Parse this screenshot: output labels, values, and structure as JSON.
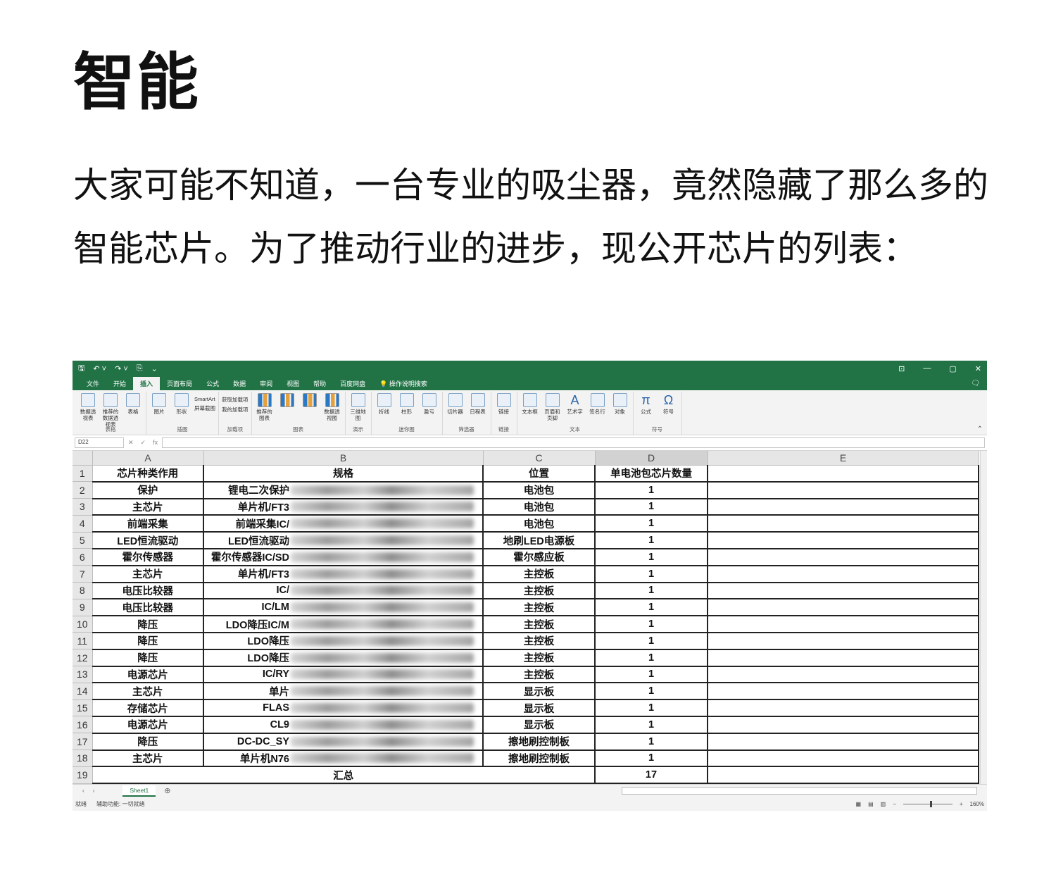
{
  "heading": "智能",
  "intro": "大家可能不知道，一台专业的吸尘器，竟然隐藏了那么多的智能芯片。为了推动行业的进步，现公开芯片的列表：",
  "excel": {
    "quick_access": [
      "🖫",
      "↶ ˅",
      "↷ ˅",
      "⎘",
      "⌄"
    ],
    "window_controls": [
      "⊡",
      "—",
      "▢",
      "✕"
    ],
    "tabs": [
      "文件",
      "开始",
      "插入",
      "页面布局",
      "公式",
      "数据",
      "审阅",
      "视图",
      "帮助",
      "百度网盘"
    ],
    "active_tab": "插入",
    "tell_me": "操作说明搜索",
    "ribbon": {
      "tables": {
        "label": "表格",
        "pivot": "数据透视表",
        "recommended_pivot": "推荐的数据透视表",
        "table": "表格"
      },
      "illustrations": {
        "label": "插图",
        "pictures": "图片",
        "shapes": "形状",
        "smartart": "SmartArt",
        "screenshot": "屏幕截图"
      },
      "addins": {
        "label": "加载项",
        "get": "获取加载项",
        "mine": "我的加载项"
      },
      "charts": {
        "label": "图表",
        "recommended": "推荐的图表",
        "pivotchart": "数据透视图"
      },
      "tours": {
        "label": "演示",
        "map3d": "三维地图"
      },
      "sparklines": {
        "label": "迷你图",
        "line": "折线",
        "column": "柱形",
        "winloss": "盈亏"
      },
      "filters": {
        "label": "筛选器",
        "slicer": "切片器",
        "timeline": "日程表"
      },
      "links": {
        "label": "链接",
        "link": "链接"
      },
      "text": {
        "label": "文本",
        "textbox": "文本框",
        "header": "页眉和页脚",
        "wordart": "艺术字",
        "signature": "签名行",
        "object": "对象"
      },
      "symbols": {
        "label": "符号",
        "equation": "公式",
        "symbol": "符号"
      }
    },
    "name_box": "D22",
    "fx": "fx",
    "columns": [
      "A",
      "B",
      "C",
      "D",
      "E"
    ],
    "header_row": [
      "芯片种类作用",
      "规格",
      "位置",
      "单电池包芯片数量"
    ],
    "rows": [
      {
        "n": "2",
        "a": "保护",
        "b": "锂电二次保护",
        "c": "电池包",
        "d": "1"
      },
      {
        "n": "3",
        "a": "主芯片",
        "b": "单片机/FT3",
        "c": "电池包",
        "d": "1"
      },
      {
        "n": "4",
        "a": "前端采集",
        "b": "前端采集IC/",
        "c": "电池包",
        "d": "1"
      },
      {
        "n": "5",
        "a": "LED恒流驱动",
        "b": "LED恒流驱动",
        "c": "地刷LED电源板",
        "d": "1"
      },
      {
        "n": "6",
        "a": "霍尔传感器",
        "b": "霍尔传感器IC/SD",
        "c": "霍尔感应板",
        "d": "1"
      },
      {
        "n": "7",
        "a": "主芯片",
        "b": "单片机/FT3",
        "c": "主控板",
        "d": "1"
      },
      {
        "n": "8",
        "a": "电压比较器",
        "b": "IC/",
        "c": "主控板",
        "d": "1"
      },
      {
        "n": "9",
        "a": "电压比较器",
        "b": "IC/LM",
        "c": "主控板",
        "d": "1"
      },
      {
        "n": "10",
        "a": "降压",
        "b": "LDO降压IC/M",
        "c": "主控板",
        "d": "1"
      },
      {
        "n": "11",
        "a": "降压",
        "b": "LDO降压",
        "c": "主控板",
        "d": "1"
      },
      {
        "n": "12",
        "a": "降压",
        "b": "LDO降压",
        "c": "主控板",
        "d": "1"
      },
      {
        "n": "13",
        "a": "电源芯片",
        "b": "IC/RY",
        "c": "主控板",
        "d": "1"
      },
      {
        "n": "14",
        "a": "主芯片",
        "b": "单片",
        "c": "显示板",
        "d": "1"
      },
      {
        "n": "15",
        "a": "存储芯片",
        "b": "FLAS",
        "c": "显示板",
        "d": "1"
      },
      {
        "n": "16",
        "a": "电源芯片",
        "b": "CL9",
        "c": "显示板",
        "d": "1"
      },
      {
        "n": "17",
        "a": "降压",
        "b": "DC-DC_SY",
        "c": "擦地刷控制板",
        "d": "1"
      },
      {
        "n": "18",
        "a": "主芯片",
        "b": "单片机N76",
        "c": "擦地刷控制板",
        "d": "1"
      }
    ],
    "total_row": {
      "n": "19",
      "label": "汇总",
      "value": "17"
    },
    "header_row_num": "1",
    "sheet_tab": "Sheet1",
    "status": {
      "ready": "就绪",
      "accessibility": "辅助功能: 一切就绪",
      "zoom": "160%"
    }
  }
}
